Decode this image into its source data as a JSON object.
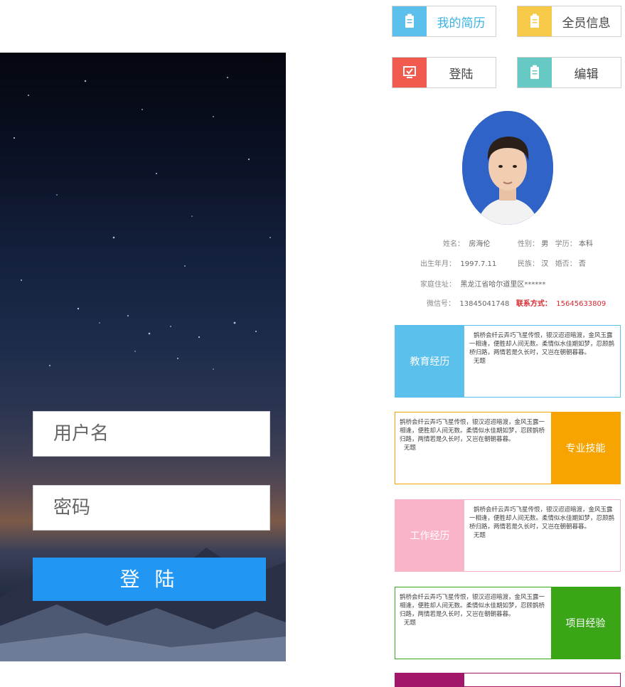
{
  "login": {
    "username_placeholder": "用户名",
    "password_placeholder": "密码",
    "submit_label": "登 陆"
  },
  "nav": {
    "my_resume": "我的简历",
    "all_info": "全员信息",
    "login": "登陆",
    "edit": "编辑"
  },
  "profile": {
    "name_label": "姓名：",
    "name_value": "房海伦",
    "gender_label": "性别：",
    "gender_value": "男",
    "edu_label": "学历：",
    "edu_value": "本科",
    "birth_label": "出生年月：",
    "birth_value": "1997.7.11",
    "ethnic_label": "民族：",
    "ethnic_value": "汉",
    "married_label": "婚否：",
    "married_value": "否",
    "address_label": "家庭住址：",
    "address_value": "黑龙江省哈尔道里区******",
    "wechat_label": "微信号：",
    "wechat_value": "13845041748",
    "contact_label": "联系方式：",
    "contact_value": "15645633809"
  },
  "sections": {
    "education": {
      "title": "教育经历",
      "text": "鹊桥会纤云弄巧飞星传恨，银汉迢迢暗渡，金风玉露一相逢，便胜却人间无数。柔情似水佳期如梦，忍顾鹊桥归路，两情若是久长时，又岂在朝朝暮暮。",
      "sign": "无题"
    },
    "skills": {
      "title": "专业技能",
      "text": "鹊桥会纤云弄巧飞星传恨，银汉迢迢暗渡，金风玉露一相逢，便胜却人间无数。柔情似水佳期如梦，忍顾鹊桥归路，两情若是久长时，又岂在朝朝暮暮。",
      "sign": "无题"
    },
    "work": {
      "title": "工作经历",
      "text": "鹊桥会纤云弄巧飞星传恨，银汉迢迢暗渡，金风玉露一相逢，便胜却人间无数。柔情似水佳期如梦，忍顾鹊桥归路，两情若是久长时，又岂在朝朝暮暮。",
      "sign": "无题"
    },
    "project": {
      "title": "项目经验",
      "text": "鹊桥会纤云弄巧飞星传恨，银汉迢迢暗渡，金风玉露一相逢，便胜却人间无数。柔情似水佳期如梦，忍顾鹊桥归路，两情若是久长时，又岂在朝朝暮暮。",
      "sign": "无题"
    }
  },
  "colors": {
    "login_button": "#2196f3",
    "education": "#5bc0eb",
    "skills": "#f7a400",
    "work": "#f9b4c8",
    "project": "#3aa517",
    "extra": "#a3176b"
  },
  "icons": [
    "document-icon",
    "document-icon",
    "presentation-icon",
    "document-icon"
  ]
}
